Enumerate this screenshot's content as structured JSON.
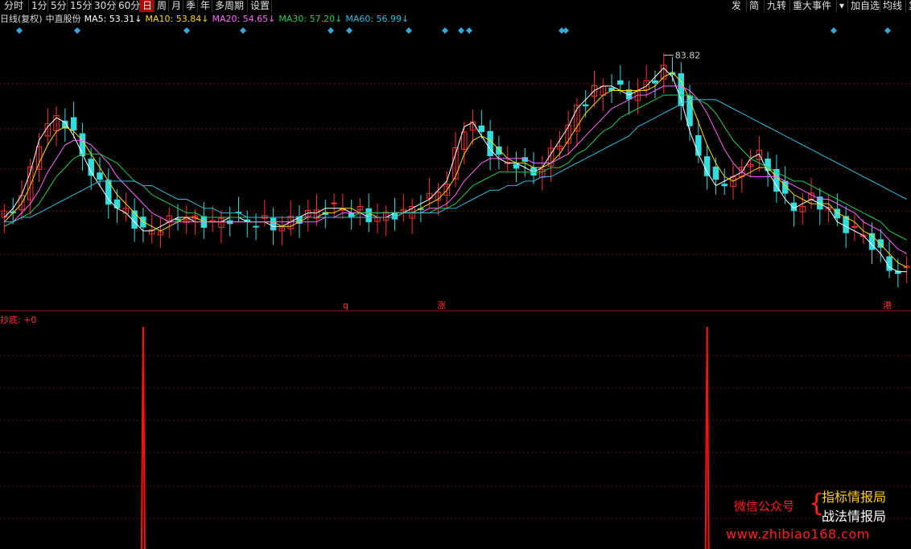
{
  "toolbar": {
    "left": [
      "分时",
      "1分",
      "5分",
      "15分",
      "30分",
      "60分",
      "日",
      "周",
      "月",
      "季",
      "年",
      "多周期",
      "设置"
    ],
    "active_index": 6,
    "right": [
      "发",
      "简",
      "九转",
      "重大事件",
      "加自选",
      "均线",
      "复"
    ]
  },
  "chart_title": "日线(复权)",
  "stock_name": "中直股份",
  "ma_legend": [
    {
      "label": "MA5: 53.31↓",
      "color": "#ffffff"
    },
    {
      "label": "MA10: 53.84↓",
      "color": "#ffd700"
    },
    {
      "label": "MA20: 54.65↓",
      "color": "#ff66ff"
    },
    {
      "label": "MA30: 57.20↓",
      "color": "#22cc55"
    },
    {
      "label": "MA60: 56.99↓",
      "color": "#33bbdd"
    }
  ],
  "indicator_label": "抄底: +0",
  "high_label": "83.82",
  "markers": {
    "q": "q",
    "zhang": "涨",
    "gang": "港"
  },
  "watermark": {
    "left": "微信公众号",
    "right_top": "指标情报局",
    "right_bottom": "战法情报局",
    "url": "www.zhibiao168.com"
  },
  "chart_data": [
    {
      "type": "line",
      "title": "日线(复权)",
      "series": [
        {
          "name": "MA5",
          "color": "#ffffff",
          "values": [
            48,
            50,
            53,
            58,
            65,
            68,
            70,
            69,
            66,
            62,
            58,
            55,
            52,
            50,
            49,
            47,
            45,
            45,
            46,
            47,
            48,
            48,
            47,
            47,
            47,
            47,
            48,
            48,
            47,
            47,
            47,
            46,
            46,
            47,
            48,
            49,
            49,
            50,
            50,
            50,
            49,
            49,
            48,
            48,
            48,
            49,
            49,
            50,
            51,
            52,
            54,
            56,
            62,
            68,
            69,
            66,
            63,
            61,
            60,
            60,
            59,
            58,
            59,
            62,
            65,
            68,
            72,
            74,
            76,
            77,
            77,
            76,
            75,
            76,
            77,
            79,
            81,
            79,
            74,
            67,
            62,
            58,
            55,
            56,
            57,
            58,
            61,
            62,
            58,
            55,
            52,
            50,
            51,
            52,
            51,
            50,
            47,
            46,
            45,
            44,
            42,
            40,
            37,
            36,
            36
          ]
        },
        {
          "name": "MA10",
          "color": "#ffd700",
          "values": [
            47,
            49,
            51,
            55,
            60,
            64,
            67,
            68,
            67,
            65,
            62,
            59,
            56,
            53,
            51,
            49,
            47,
            46,
            45,
            46,
            47,
            48,
            48,
            47,
            47,
            47,
            47,
            47,
            47,
            47,
            47,
            47,
            46,
            46,
            47,
            48,
            48,
            49,
            49,
            50,
            50,
            49,
            49,
            48,
            48,
            48,
            49,
            49,
            50,
            51,
            52,
            54,
            57,
            62,
            65,
            66,
            65,
            63,
            61,
            60,
            60,
            59,
            59,
            60,
            62,
            65,
            68,
            71,
            73,
            75,
            76,
            76,
            76,
            76,
            76,
            77,
            79,
            80,
            78,
            74,
            69,
            64,
            60,
            57,
            56,
            57,
            58,
            59,
            59,
            57,
            55,
            53,
            52,
            51,
            51,
            51,
            49,
            48,
            47,
            45,
            44,
            42,
            40,
            38,
            37
          ]
        },
        {
          "name": "MA20",
          "color": "#ff66ff",
          "values": [
            46,
            47,
            49,
            51,
            54,
            58,
            61,
            64,
            65,
            65,
            64,
            62,
            60,
            57,
            55,
            53,
            51,
            49,
            48,
            47,
            47,
            47,
            47,
            47,
            47,
            47,
            47,
            47,
            47,
            47,
            47,
            47,
            47,
            47,
            47,
            47,
            47,
            48,
            48,
            49,
            49,
            49,
            49,
            49,
            49,
            49,
            49,
            49,
            49,
            50,
            50,
            51,
            53,
            56,
            58,
            60,
            61,
            61,
            61,
            61,
            61,
            60,
            60,
            60,
            61,
            62,
            64,
            66,
            68,
            70,
            72,
            73,
            74,
            75,
            75,
            76,
            77,
            77,
            77,
            76,
            74,
            71,
            67,
            63,
            60,
            58,
            57,
            57,
            57,
            57,
            56,
            55,
            54,
            53,
            52,
            52,
            51,
            50,
            49,
            47,
            46,
            45,
            43,
            41,
            40
          ]
        },
        {
          "name": "MA30",
          "color": "#22cc55",
          "values": [
            46,
            47,
            48,
            49,
            51,
            54,
            57,
            59,
            61,
            62,
            62,
            62,
            61,
            60,
            58,
            56,
            55,
            53,
            52,
            51,
            50,
            49,
            49,
            48,
            48,
            48,
            48,
            48,
            48,
            48,
            48,
            48,
            48,
            48,
            48,
            48,
            48,
            48,
            48,
            48,
            48,
            49,
            49,
            49,
            49,
            49,
            49,
            49,
            49,
            49,
            50,
            50,
            51,
            53,
            55,
            56,
            57,
            58,
            58,
            58,
            58,
            58,
            58,
            59,
            59,
            60,
            62,
            63,
            65,
            67,
            68,
            70,
            71,
            72,
            73,
            74,
            75,
            75,
            75,
            75,
            74,
            73,
            71,
            68,
            65,
            63,
            61,
            60,
            59,
            58,
            57,
            56,
            56,
            55,
            54,
            53,
            52,
            51,
            50,
            49,
            48,
            47,
            45,
            44,
            43
          ]
        },
        {
          "name": "MA60",
          "color": "#33bbdd",
          "values": [
            47,
            47,
            48,
            48,
            49,
            50,
            51,
            52,
            53,
            54,
            55,
            56,
            56,
            56,
            56,
            56,
            55,
            55,
            54,
            53,
            52,
            52,
            51,
            50,
            50,
            49,
            49,
            49,
            48,
            48,
            48,
            48,
            48,
            48,
            48,
            48,
            48,
            48,
            48,
            48,
            48,
            48,
            48,
            48,
            48,
            48,
            49,
            49,
            49,
            49,
            49,
            50,
            50,
            51,
            52,
            53,
            54,
            54,
            55,
            55,
            56,
            56,
            57,
            57,
            58,
            59,
            60,
            61,
            62,
            63,
            64,
            65,
            66,
            68,
            69,
            70,
            71,
            72,
            73,
            74,
            74,
            74,
            74,
            73,
            72,
            71,
            70,
            69,
            68,
            67,
            66,
            65,
            64,
            63,
            62,
            61,
            60,
            59,
            58,
            57,
            56,
            55,
            54,
            53,
            52
          ]
        }
      ],
      "high": 83.82
    },
    {
      "type": "bar",
      "title": "抄底",
      "signals": [
        {
          "index": 16,
          "value": 1
        },
        {
          "index": 81,
          "value": 1
        }
      ],
      "value": 0
    }
  ]
}
